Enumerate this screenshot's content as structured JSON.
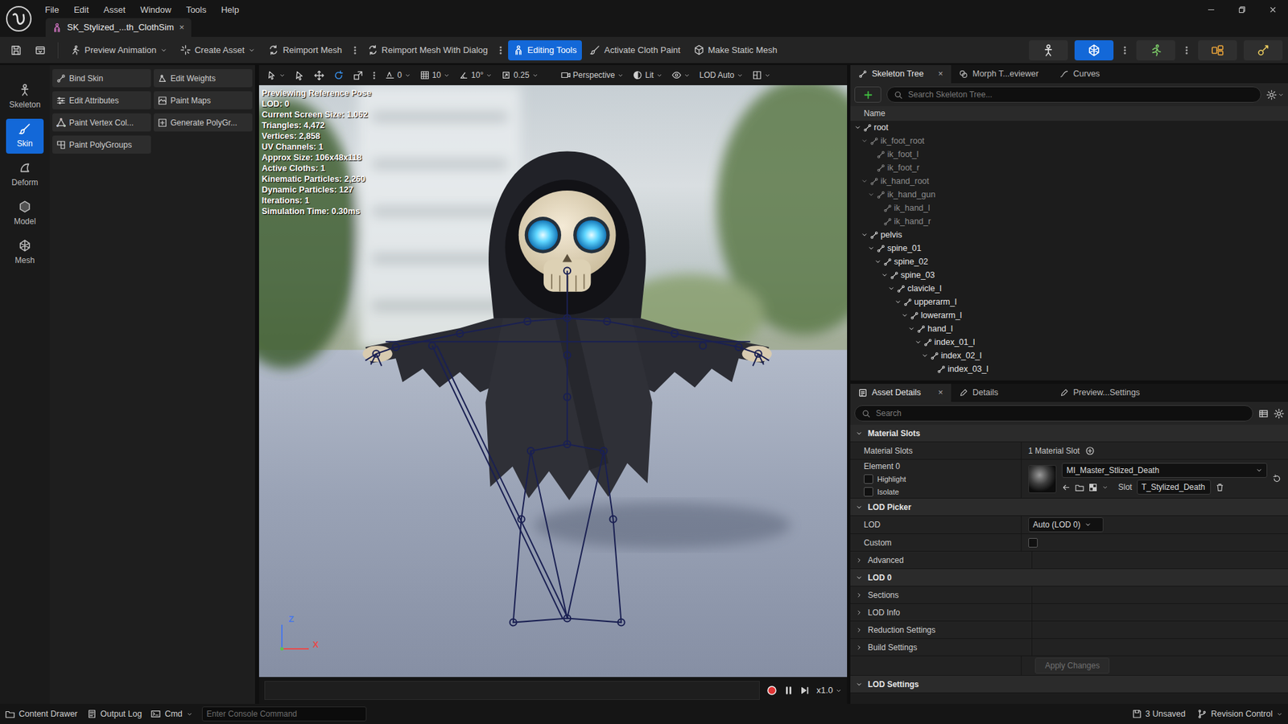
{
  "menu": [
    "File",
    "Edit",
    "Asset",
    "Window",
    "Tools",
    "Help"
  ],
  "asset_tab": {
    "label": "SK_Stylized_...th_ClothSim",
    "close": "×",
    "selected": true
  },
  "toolbar": {
    "items": [
      {
        "label": "Preview Animation",
        "dropdown": true,
        "selected": false,
        "options_menu": false
      },
      {
        "label": "Create Asset",
        "dropdown": true,
        "selected": false,
        "options_menu": false
      },
      {
        "label": "Reimport Mesh",
        "dropdown": false,
        "selected": false,
        "options_menu": true
      },
      {
        "label": "Reimport Mesh With Dialog",
        "dropdown": false,
        "selected": false,
        "options_menu": true
      },
      {
        "label": "Editing Tools",
        "dropdown": false,
        "selected": true,
        "options_menu": false
      },
      {
        "label": "Activate Cloth Paint",
        "dropdown": false,
        "selected": false,
        "options_menu": false
      },
      {
        "label": "Make Static Mesh",
        "dropdown": false,
        "selected": false,
        "options_menu": false
      }
    ],
    "modes": [
      {
        "selected": false
      },
      {
        "selected": true
      },
      {
        "selected": false
      },
      {
        "selected": false
      },
      {
        "selected": false
      }
    ]
  },
  "mode_bar": [
    {
      "label": "Skeleton",
      "selected": false
    },
    {
      "label": "Skin",
      "selected": true
    },
    {
      "label": "Deform",
      "selected": false
    },
    {
      "label": "Model",
      "selected": false
    },
    {
      "label": "Mesh",
      "selected": false
    }
  ],
  "tools": [
    "Bind Skin",
    "Edit Weights",
    "Edit Attributes",
    "Paint Maps",
    "Paint Vertex Col...",
    "Generate PolyGr...",
    "Paint PolyGroups"
  ],
  "viewport": {
    "transform_tools": [
      {
        "selected": false
      },
      {
        "selected": false
      },
      {
        "selected": true
      },
      {
        "selected": false
      }
    ],
    "snaps": [
      {
        "value": "0"
      },
      {
        "value": "10"
      },
      {
        "value": "10°"
      },
      {
        "value": "0.25"
      }
    ],
    "view_mode": "Perspective",
    "lighting": "Lit",
    "lod": "LOD Auto",
    "stats": [
      "Previewing Reference Pose",
      "LOD: 0",
      "Current Screen Size: 1.062",
      "Triangles: 4,472",
      "Vertices: 2,858",
      "UV Channels: 1",
      "Approx Size: 106x48x118",
      "Active Cloths: 1",
      "Kinematic Particles: 2,260",
      "Dynamic Particles: 127",
      "Iterations: 1",
      "Simulation Time: 0.30ms"
    ],
    "axes": {
      "z": "Z",
      "x": "X"
    },
    "playback": {
      "speed": "x1.0",
      "playing": true
    }
  },
  "skeleton_tree": {
    "tabs": [
      {
        "label": "Skeleton Tree",
        "selected": true,
        "close": "×"
      },
      {
        "label": "Morph T...eviewer",
        "selected": false
      },
      {
        "label": "Curves",
        "selected": false
      }
    ],
    "search": {
      "placeholder": "Search Skeleton Tree..."
    },
    "column": "Name",
    "bones": [
      {
        "name": "root",
        "depth": 0,
        "kind": "branch",
        "expanded": true,
        "dimmed": false
      },
      {
        "name": "ik_foot_root",
        "depth": 1,
        "kind": "branch",
        "expanded": true,
        "dimmed": true
      },
      {
        "name": "ik_foot_l",
        "depth": 2,
        "kind": "leaf",
        "expanded": false,
        "dimmed": true
      },
      {
        "name": "ik_foot_r",
        "depth": 2,
        "kind": "leaf",
        "expanded": false,
        "dimmed": true
      },
      {
        "name": "ik_hand_root",
        "depth": 1,
        "kind": "branch",
        "expanded": true,
        "dimmed": true
      },
      {
        "name": "ik_hand_gun",
        "depth": 2,
        "kind": "branch",
        "expanded": true,
        "dimmed": true
      },
      {
        "name": "ik_hand_l",
        "depth": 3,
        "kind": "leaf",
        "expanded": false,
        "dimmed": true
      },
      {
        "name": "ik_hand_r",
        "depth": 3,
        "kind": "leaf",
        "expanded": false,
        "dimmed": true
      },
      {
        "name": "pelvis",
        "depth": 1,
        "kind": "branch",
        "expanded": true,
        "dimmed": false
      },
      {
        "name": "spine_01",
        "depth": 2,
        "kind": "branch",
        "expanded": true,
        "dimmed": false
      },
      {
        "name": "spine_02",
        "depth": 3,
        "kind": "branch",
        "expanded": true,
        "dimmed": false
      },
      {
        "name": "spine_03",
        "depth": 4,
        "kind": "branch",
        "expanded": true,
        "dimmed": false
      },
      {
        "name": "clavicle_l",
        "depth": 5,
        "kind": "branch",
        "expanded": true,
        "dimmed": false
      },
      {
        "name": "upperarm_l",
        "depth": 6,
        "kind": "branch",
        "expanded": true,
        "dimmed": false
      },
      {
        "name": "lowerarm_l",
        "depth": 7,
        "kind": "branch",
        "expanded": true,
        "dimmed": false
      },
      {
        "name": "hand_l",
        "depth": 8,
        "kind": "branch",
        "expanded": true,
        "dimmed": false
      },
      {
        "name": "index_01_l",
        "depth": 9,
        "kind": "branch",
        "expanded": true,
        "dimmed": false
      },
      {
        "name": "index_02_l",
        "depth": 10,
        "kind": "branch",
        "expanded": true,
        "dimmed": false
      },
      {
        "name": "index_03_l",
        "depth": 11,
        "kind": "leaf",
        "expanded": false,
        "dimmed": false
      }
    ]
  },
  "details": {
    "tabs": [
      {
        "label": "Asset Details",
        "selected": true,
        "close": "×"
      },
      {
        "label": "Details",
        "selected": false
      },
      {
        "label": "Preview...Settings",
        "selected": false
      }
    ],
    "search": {
      "placeholder": "Search"
    },
    "rows": [
      {
        "kind": "category",
        "label": "Material Slots",
        "expanded": true
      },
      {
        "kind": "text",
        "label": "Material Slots",
        "value": "1 Material Slot"
      },
      {
        "kind": "material",
        "label": "Element 0",
        "material": "MI_Master_Stlized_Death",
        "slot_label": "Slot",
        "slot": "T_Stylized_Death",
        "options": [
          {
            "label": "Highlight",
            "checked": false
          },
          {
            "label": "Isolate",
            "checked": false
          }
        ]
      },
      {
        "kind": "category",
        "label": "LOD Picker",
        "expanded": true
      },
      {
        "kind": "dropdown",
        "label": "LOD",
        "value": "Auto (LOD 0)"
      },
      {
        "kind": "checkbox",
        "label": "Custom",
        "checked": false
      },
      {
        "kind": "group",
        "label": "Advanced",
        "expanded": false
      },
      {
        "kind": "category",
        "label": "LOD 0",
        "expanded": true
      },
      {
        "kind": "group",
        "label": "Sections",
        "expanded": false
      },
      {
        "kind": "group",
        "label": "LOD Info",
        "expanded": false
      },
      {
        "kind": "group",
        "label": "Reduction Settings",
        "expanded": false
      },
      {
        "kind": "group",
        "label": "Build Settings",
        "expanded": false
      },
      {
        "kind": "button",
        "label": "Apply Changes",
        "disabled": true
      },
      {
        "kind": "category",
        "label": "LOD Settings",
        "expanded": true
      }
    ]
  },
  "status_bar": {
    "left": [
      {
        "label": "Content Drawer",
        "dropdown": false
      },
      {
        "label": "Output Log",
        "dropdown": false
      },
      {
        "label": "Cmd",
        "dropdown": true
      }
    ],
    "console": {
      "placeholder": "Enter Console Command"
    },
    "right": [
      {
        "label": "3 Unsaved",
        "dropdown": false
      },
      {
        "label": "Revision Control",
        "dropdown": true
      }
    ]
  }
}
